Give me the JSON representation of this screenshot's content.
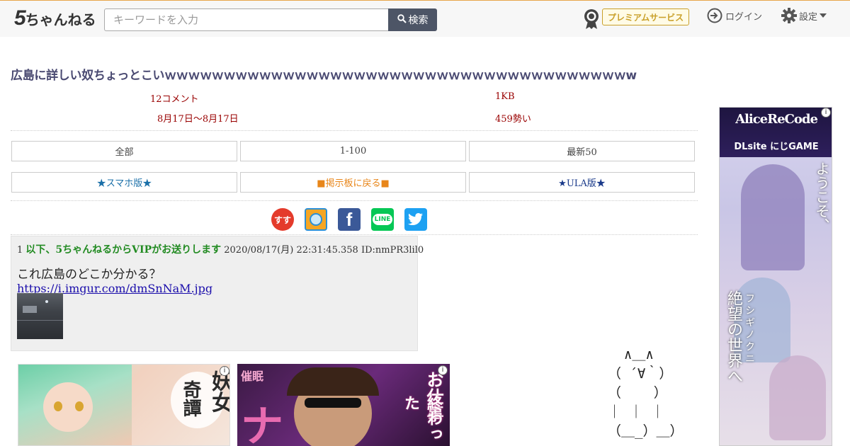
{
  "header": {
    "logo_five": "5",
    "logo_rest": "ちゃんねる",
    "search_placeholder": "キーワードを入力",
    "search_button": "検索",
    "premium": "プレミアムサービス",
    "login": "ログイン",
    "settings": "設定"
  },
  "thread": {
    "title": "広島に詳しい奴ちょっとこいｗｗｗｗｗｗｗｗｗｗｗｗｗｗｗｗｗｗｗｗｗｗｗｗｗｗｗｗｗｗｗｗｗｗｗｗｗｗｗw",
    "comments": "12コメント",
    "size": "1KB",
    "date_range": "8月17日〜8月17日",
    "momentum": "459勢い"
  },
  "nav": {
    "all": "全部",
    "range": "1-100",
    "latest": "最新50",
    "smartphone": "★スマホ版★",
    "back": "■掲示板に戻る■",
    "ula": "★ULA版★"
  },
  "share": {
    "sukusuku": "すす",
    "facebook": "f",
    "line": "LINE",
    "twitter": "twitter"
  },
  "post": {
    "number": "1",
    "name": "以下、5ちゃんねるからVIPがお送りします",
    "datetime": "2020/08/17(月) 22:31:45.358",
    "id": "ID:nmPR3lil0",
    "body": "これ広島のどこか分かる？",
    "link": "https://i.imgur.com/dmSnNaM.jpg"
  },
  "ads": {
    "ad1_title_a": "妖女",
    "ad1_title_b": "奇譚",
    "ad2_top": "お仕事",
    "ad2_mid": "終わった",
    "ad2_big": "ナ",
    "side_logo": "AliceReCode",
    "side_sub": "DLsite にじGAME",
    "side_v1": "ようこそ、",
    "side_v2": "絶望の世界へ",
    "side_v3": "フシギノクニ",
    "info": "i"
  },
  "ascii_art": "  ∧＿∧\n（ ´∀｀）\n（    ）\n｜ ｜ ｜\n（＿_）＿）"
}
